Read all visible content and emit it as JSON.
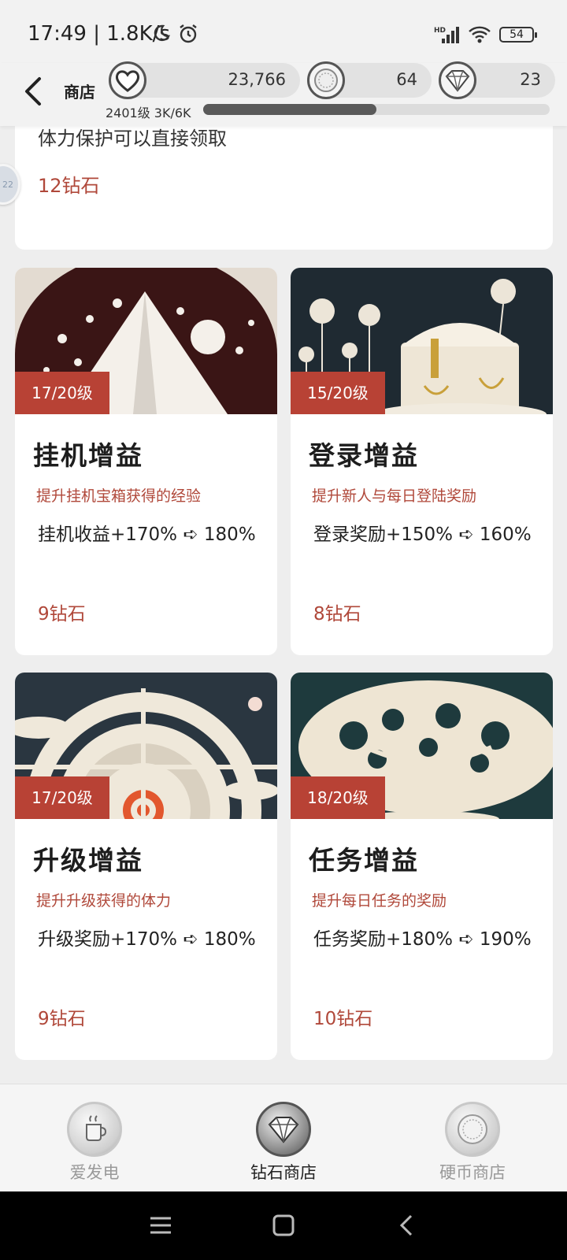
{
  "status_bar": {
    "time": "17:49 | 1.8K/s",
    "battery": "54",
    "icons": [
      "moon-icon",
      "alarm-icon",
      "signal-icon",
      "wifi-icon",
      "battery-icon"
    ]
  },
  "header": {
    "title": "商店",
    "currencies": [
      {
        "icon": "heart-icon",
        "value": "23,766"
      },
      {
        "icon": "coin-icon",
        "value": "64"
      },
      {
        "icon": "diamond-icon",
        "value": "23"
      }
    ],
    "level_text": "2401级 3K/6K",
    "level_progress": 0.5
  },
  "top_card": {
    "desc": "体力保护可以直接领取",
    "price": "12钻石"
  },
  "float_ball_text": "22",
  "cards": [
    {
      "badge": "17/20级",
      "name": "挂机增益",
      "sub": "提升挂机宝箱获得的经验",
      "effect": "挂机收益+170% ➪ 180%",
      "cost": "9钻石",
      "image": "paper-mountain-stars"
    },
    {
      "badge": "15/20级",
      "name": "登录增益",
      "sub": "提升新人与每日登陆奖励",
      "effect": "登录奖励+150% ➪ 160%",
      "cost": "8钻石",
      "image": "paper-treasure-chest"
    },
    {
      "badge": "17/20级",
      "name": "升级增益",
      "sub": "提升升级获得的体力",
      "effect": "升级奖励+170% ➪ 180%",
      "cost": "9钻石",
      "image": "paper-target"
    },
    {
      "badge": "18/20级",
      "name": "任务增益",
      "sub": "提升每日任务的奖励",
      "effect": "任务奖励+180% ➪ 190%",
      "cost": "10钻石",
      "image": "paper-tree"
    }
  ],
  "bottom_nav": [
    {
      "label": "爱发电",
      "icon": "cup-icon",
      "active": false
    },
    {
      "label": "钻石商店",
      "icon": "diamond-icon",
      "active": true
    },
    {
      "label": "硬币商店",
      "icon": "coin-icon",
      "active": false
    }
  ],
  "colors": {
    "accent": "#b84235",
    "price": "#b0483a",
    "background": "#eeeeee"
  }
}
